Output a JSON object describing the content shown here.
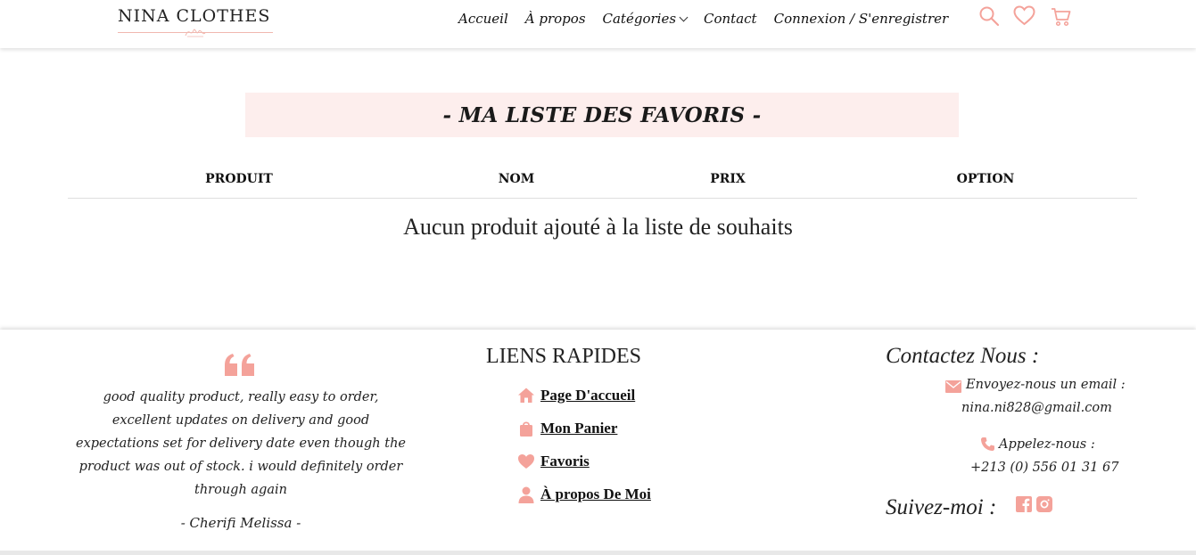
{
  "brand": {
    "name": "NINA CLOTHES",
    "accent_color": "#f4a29a",
    "title_bg": "#fdeeed"
  },
  "nav": {
    "items": [
      "Accueil",
      "À propos",
      "Catégories",
      "Contact",
      "Connexion / S'enregistrer"
    ],
    "icons": [
      "search-icon",
      "heart-icon",
      "cart-icon"
    ]
  },
  "wishlist": {
    "title": "- MA LISTE DES FAVORIS -",
    "columns": [
      "PRODUIT",
      "NOM",
      "PRIX",
      "OPTION"
    ],
    "empty_message": "Aucun produit ajouté à la liste de souhaits"
  },
  "footer": {
    "testimonial": {
      "quote": "good quality product, really easy to order, excellent updates on delivery and good expectations set for delivery date even though the product was out of stock. i would definitely order through again",
      "author": "- Cherifi Melissa -"
    },
    "quick_links": {
      "title": "LIENS RAPIDES",
      "items": [
        {
          "label": "Page D'accueil",
          "icon": "home-icon"
        },
        {
          "label": "Mon Panier",
          "icon": "bag-icon"
        },
        {
          "label": "Favoris",
          "icon": "heart-icon"
        },
        {
          "label": "À propos De Moi",
          "icon": "user-icon"
        }
      ]
    },
    "contact": {
      "title": "Contactez Nous :",
      "email_label": "Envoyez-nous un email :",
      "email": "nina.ni828@gmail.com",
      "phone_label": "Appelez-nous :",
      "phone": "+213 (0) 556 01 31 67",
      "follow_label": "Suivez-moi :",
      "social": [
        "facebook-icon",
        "instagram-icon"
      ]
    }
  }
}
